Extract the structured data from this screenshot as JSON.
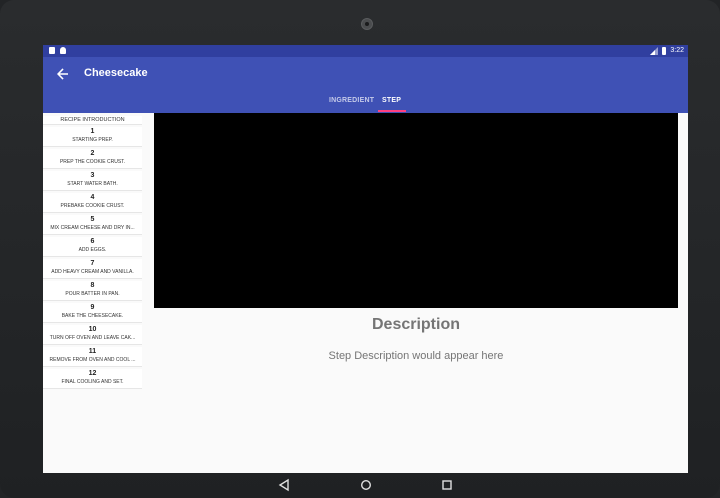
{
  "status_bar": {
    "time": "3:22"
  },
  "toolbar": {
    "title": "Cheesecake",
    "back_icon": "arrow-back-icon"
  },
  "tabs": [
    {
      "label": "INGREDIENT",
      "selected": false
    },
    {
      "label": "STEP",
      "selected": true
    }
  ],
  "steps": {
    "intro": "RECIPE INTRODUCTION",
    "items": [
      {
        "number": "1",
        "label": "STARTING PREP."
      },
      {
        "number": "2",
        "label": "PREP THE COOKIE CRUST."
      },
      {
        "number": "3",
        "label": "START WATER BATH."
      },
      {
        "number": "4",
        "label": "PREBAKE COOKIE CRUST."
      },
      {
        "number": "5",
        "label": "MIX CREAM CHEESE AND DRY IN..."
      },
      {
        "number": "6",
        "label": "ADD EGGS."
      },
      {
        "number": "7",
        "label": "ADD HEAVY CREAM AND VANILLA."
      },
      {
        "number": "8",
        "label": "POUR BATTER IN PAN."
      },
      {
        "number": "9",
        "label": "BAKE THE CHEESECAKE."
      },
      {
        "number": "10",
        "label": "TURN OFF OVEN AND LEAVE CAK..."
      },
      {
        "number": "11",
        "label": "REMOVE FROM OVEN AND COOL ..."
      },
      {
        "number": "12",
        "label": "FINAL COOLING AND SET."
      }
    ]
  },
  "detail": {
    "title": "Description",
    "text": "Step Description would appear here"
  },
  "colors": {
    "primary": "#3f51b5",
    "primary_dark": "#303f9f",
    "accent": "#ff4081"
  }
}
